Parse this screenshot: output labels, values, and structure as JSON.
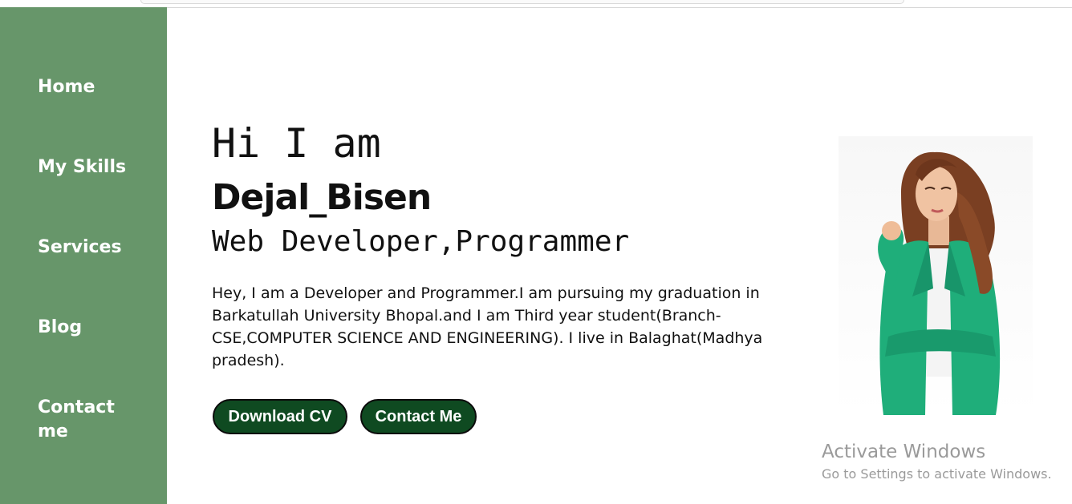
{
  "nav": {
    "items": [
      {
        "label": "Home"
      },
      {
        "label": "My Skills"
      },
      {
        "label": "Services"
      },
      {
        "label": "Blog"
      },
      {
        "label": "Contact me"
      }
    ]
  },
  "hero": {
    "greeting": "Hi I am",
    "name": "Dejal_Bisen",
    "role": "Web Developer,Programmer",
    "bio": "Hey, I am a Developer and Programmer.I am pursuing my graduation in Barkatullah University Bhopal.and I am Third year student(Branch-CSE,COMPUTER SCIENCE AND ENGINEERING). I live in Balaghat(Madhya pradesh).",
    "buttons": {
      "download_cv": "Download CV",
      "contact_me": "Contact Me"
    }
  },
  "colors": {
    "sidebar": "#67966a",
    "button_bg": "#0f4a21",
    "suit": "#1fae7a"
  },
  "watermark": {
    "title": "Activate Windows",
    "subtitle": "Go to Settings to activate Windows."
  }
}
